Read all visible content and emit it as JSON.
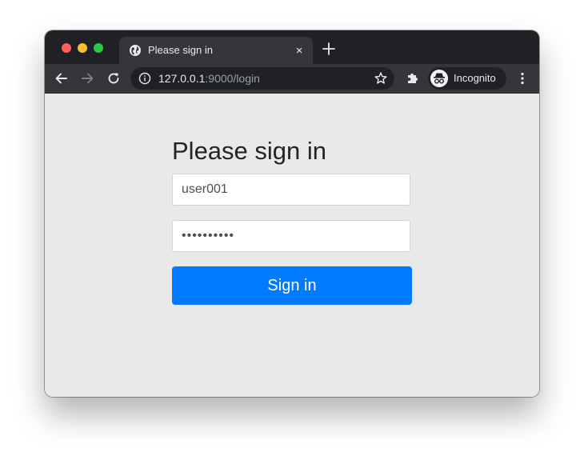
{
  "browser": {
    "tab": {
      "title": "Please sign in",
      "close_glyph": "×",
      "icon": "globe-icon"
    },
    "new_tab_icon": "plus-icon",
    "nav": {
      "back_icon": "arrow-left-icon",
      "forward_icon": "arrow-right-icon",
      "reload_icon": "reload-icon"
    },
    "address_bar": {
      "host": "127.0.0.1",
      "rest": ":9000/login",
      "info_icon": "info-icon",
      "bookmark_icon": "star-icon"
    },
    "extensions_icon": "puzzle-icon",
    "profile": {
      "label": "Incognito",
      "icon": "incognito-icon"
    },
    "menu_icon": "more-vert-icon"
  },
  "login": {
    "title": "Please sign in",
    "username_value": "user001",
    "password_value": "••••••••••",
    "submit_label": "Sign in"
  },
  "colors": {
    "primary": "#007bff",
    "page_background": "#e9e9e9",
    "chrome_dark": "#202124",
    "chrome_toolbar": "#35363a"
  }
}
